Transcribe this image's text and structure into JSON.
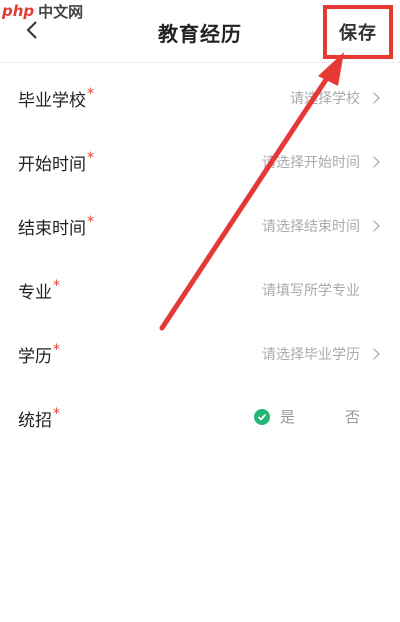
{
  "watermark": {
    "logo": "php",
    "brand": "中文网"
  },
  "header": {
    "title": "教育经历",
    "save_label": "保存"
  },
  "form": {
    "rows": [
      {
        "label": "毕业学校",
        "required_mark": "*",
        "value": "请选择学校"
      },
      {
        "label": "开始时间",
        "required_mark": "*",
        "value": "请选择开始时间"
      },
      {
        "label": "结束时间",
        "required_mark": "*",
        "value": "请选择结束时间"
      },
      {
        "label": "专业",
        "required_mark": "*",
        "value": "请填写所学专业"
      },
      {
        "label": "学历",
        "required_mark": "*",
        "value": "请选择毕业学历"
      },
      {
        "label": "统招",
        "required_mark": "*",
        "yes": "是",
        "no": "否"
      }
    ]
  },
  "colors": {
    "highlight": "#e53935",
    "check": "#22b573"
  },
  "icons": {
    "back": "chevron-left-icon",
    "chevron": "chevron-right-icon",
    "check": "check-icon"
  }
}
